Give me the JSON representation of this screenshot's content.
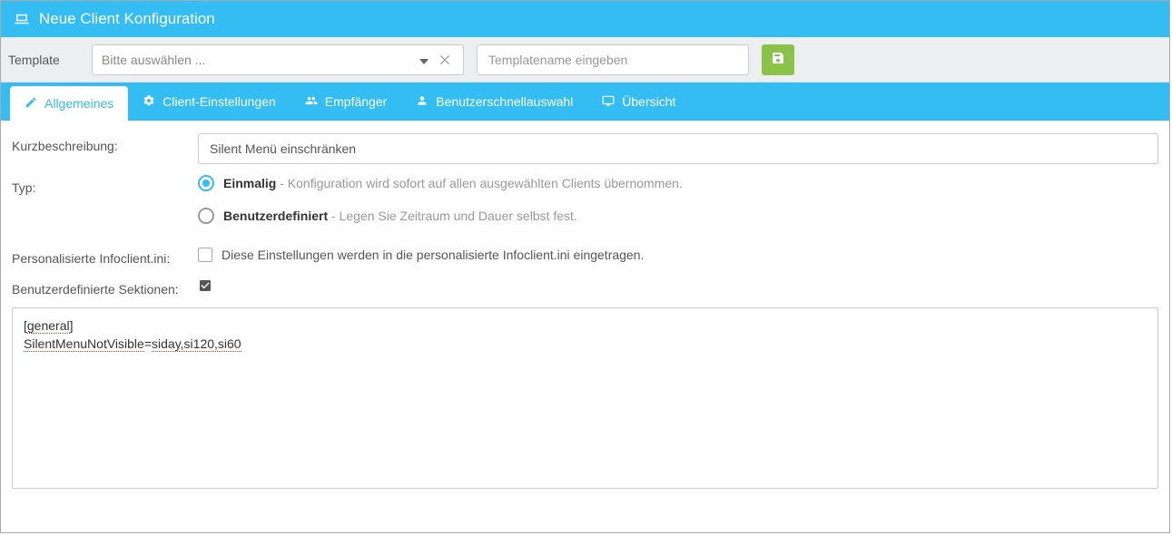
{
  "header": {
    "title": "Neue Client Konfiguration"
  },
  "templateBar": {
    "label": "Template",
    "selectPlaceholder": "Bitte auswählen ...",
    "nameInputPlaceholder": "Templatename eingeben"
  },
  "tabs": [
    {
      "label": "Allgemeines"
    },
    {
      "label": "Client-Einstellungen"
    },
    {
      "label": "Empfänger"
    },
    {
      "label": "Benutzerschnellauswahl"
    },
    {
      "label": "Übersicht"
    }
  ],
  "form": {
    "descLabel": "Kurzbeschreibung:",
    "descValue": "Silent Menü einschränken",
    "typLabel": "Typ:",
    "typOptions": {
      "opt1_strong": "Einmalig",
      "opt1_muted": " - Konfiguration wird sofort auf allen ausgewählten Clients übernommen.",
      "opt2_strong": "Benutzerdefiniert",
      "opt2_muted": " - Legen Sie Zeitraum und Dauer selbst fest."
    },
    "iniLabel": "Personalisierte Infoclient.ini:",
    "iniCheckboxText": "Diese Einstellungen werden in die personalisierte Infoclient.ini eingetragen.",
    "sectionsLabel": "Benutzerdefinierte Sektionen:",
    "code_line1_a": "[",
    "code_line1_b": "general",
    "code_line1_c": "]",
    "code_line2_a": "SilentMenuNotVisible",
    "code_line2_b": "=",
    "code_line2_c": "siday,si120,si60"
  }
}
